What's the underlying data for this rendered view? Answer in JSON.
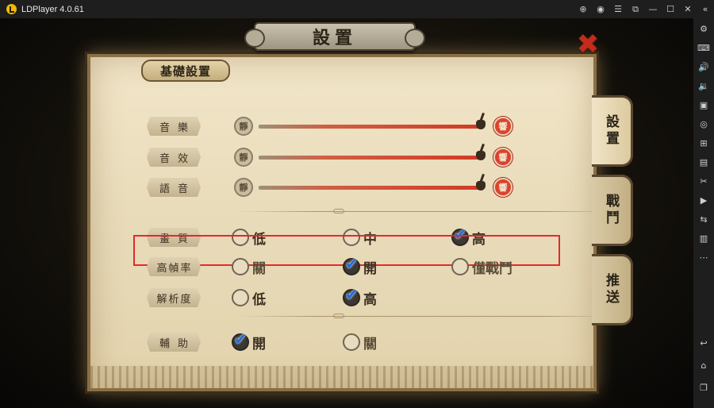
{
  "window": {
    "title": "LDPlayer 4.0.61",
    "controls": [
      "gamepad-icon",
      "user-icon",
      "menu-icon",
      "restore-icon",
      "minimize-icon",
      "maximize-icon",
      "close-icon",
      "collapse-icon"
    ]
  },
  "sidebar": {
    "icons": [
      "settings-icon",
      "keyboard-icon",
      "volume-up-icon",
      "volume-down-icon",
      "screenshot-icon",
      "record-icon",
      "add-app-icon",
      "apk-icon",
      "scissors-icon",
      "video-icon",
      "sync-icon",
      "shake-icon",
      "more-icon",
      "back-icon",
      "home-icon",
      "recents-icon"
    ]
  },
  "panel": {
    "title": "設置",
    "section": "基礎設置",
    "rows": {
      "music": {
        "label": "音樂",
        "quiet": "靜",
        "loud": "響",
        "level": 1.0
      },
      "sfx": {
        "label": "音效",
        "quiet": "靜",
        "loud": "響",
        "level": 1.0
      },
      "voice": {
        "label": "語音",
        "quiet": "靜",
        "loud": "響",
        "level": 1.0
      },
      "quality": {
        "label": "畫質",
        "options": [
          "低",
          "中",
          "高"
        ],
        "selected": 2
      },
      "fps": {
        "label": "高幀率",
        "options": [
          "關",
          "開",
          "僅戰鬥"
        ],
        "selected": 1
      },
      "resolution": {
        "label": "解析度",
        "options": [
          "低",
          "高"
        ],
        "selected": 1
      },
      "assist": {
        "label": "輔助",
        "options": [
          "開",
          "關"
        ],
        "selected": 0
      }
    },
    "tabs": [
      "設置",
      "戰鬥",
      "推送"
    ],
    "active_tab": 0
  },
  "colors": {
    "highlight": "#e12b2b",
    "check": "#1d6be0",
    "slider_fill": "#d33a23",
    "parchment": "#ece0c2"
  }
}
